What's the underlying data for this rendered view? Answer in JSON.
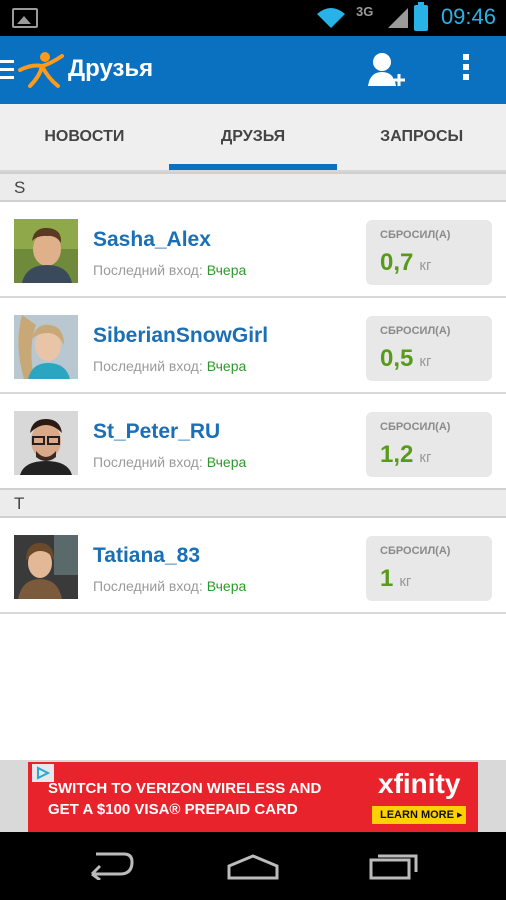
{
  "status_bar": {
    "network": "3G",
    "time": "09:46",
    "icons": [
      "gallery-icon",
      "wifi-icon",
      "signal-icon",
      "battery-icon"
    ]
  },
  "action_bar": {
    "title": "Друзья",
    "icons": [
      "menu-icon",
      "runner-logo-icon",
      "add-friend-icon",
      "overflow-menu-icon"
    ],
    "color": "#0a70c0"
  },
  "tabs": [
    {
      "label": "НОВОСТИ",
      "active": false
    },
    {
      "label": "ДРУЗЬЯ",
      "active": true
    },
    {
      "label": "ЗАПРОСЫ",
      "active": false
    }
  ],
  "sections": [
    {
      "letter": "S"
    },
    {
      "letter": "T"
    }
  ],
  "friends": [
    {
      "name": "Sasha_Alex",
      "last_login_label": "Последний вход:",
      "last_login_value": "Вчера",
      "lost_label": "СБРОСИЛ(А)",
      "lost_value": "0,7",
      "lost_unit": "кг"
    },
    {
      "name": "SiberianSnowGirl",
      "last_login_label": "Последний вход:",
      "last_login_value": "Вчера",
      "lost_label": "СБРОСИЛ(А)",
      "lost_value": "0,5",
      "lost_unit": "кг"
    },
    {
      "name": "St_Peter_RU",
      "last_login_label": "Последний вход:",
      "last_login_value": "Вчера",
      "lost_label": "СБРОСИЛ(А)",
      "lost_value": "1,2",
      "lost_unit": "кг"
    },
    {
      "name": "Tatiana_83",
      "last_login_label": "Последний вход:",
      "last_login_value": "Вчера",
      "lost_label": "СБРОСИЛ(А)",
      "lost_value": "1",
      "lost_unit": "кг"
    }
  ],
  "ad": {
    "line1": "SWITCH TO VERIZON WIRELESS AND",
    "line2": "GET A $100 VISA® PREPAID CARD",
    "brand": "xfinity",
    "button": "LEARN MORE ▸"
  },
  "nav_bar": {
    "icons": [
      "back-icon",
      "home-icon",
      "recents-icon"
    ]
  },
  "colors": {
    "accent": "#0a70c0",
    "name": "#1a6fb5",
    "online": "#2a9a2a",
    "weight": "#5a9a1a",
    "ad": "#e8232c"
  }
}
